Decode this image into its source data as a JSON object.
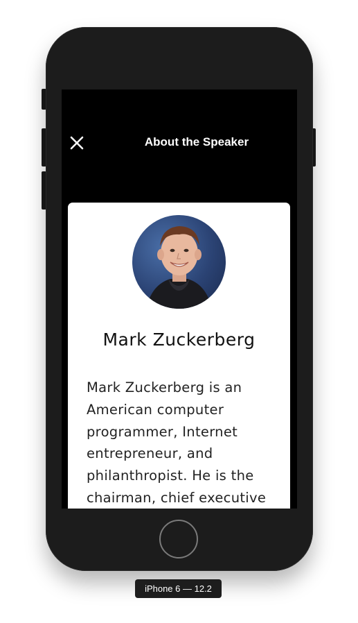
{
  "simulator": {
    "device_label": "iPhone 6 — 12.2"
  },
  "nav": {
    "title": "About the Speaker",
    "close_icon": "close-icon"
  },
  "speaker": {
    "photo_icon": "speaker-photo",
    "name": "Mark Zuckerberg",
    "bio": "Mark Zuckerberg is an American computer programmer, Internet entrepreneur, and philanthropist. He is the chairman, chief executive"
  },
  "colors": {
    "screen_background": "#000000",
    "card_background": "#ffffff",
    "phone_body": "#1c1c1c"
  }
}
